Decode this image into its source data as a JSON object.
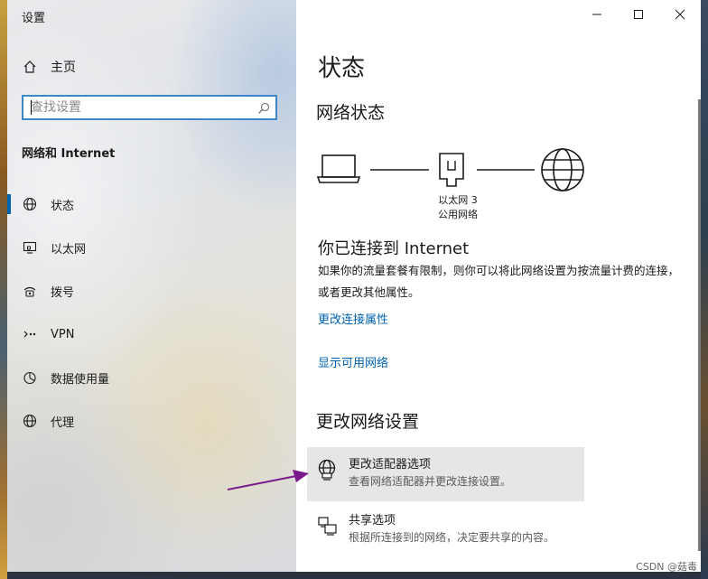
{
  "window": {
    "title": "设置",
    "controls": {
      "minimize": "—",
      "maximize": "☐",
      "close": "✕"
    }
  },
  "sidebar": {
    "home_label": "主页",
    "search_placeholder": "查找设置",
    "section_title": "网络和 Internet",
    "items": [
      {
        "label": "状态",
        "icon": "globe-icon",
        "active": true
      },
      {
        "label": "以太网",
        "icon": "ethernet-monitor-icon",
        "active": false
      },
      {
        "label": "拨号",
        "icon": "dialup-icon",
        "active": false
      },
      {
        "label": "VPN",
        "icon": "vpn-icon",
        "active": false
      },
      {
        "label": "数据使用量",
        "icon": "pie-chart-icon",
        "active": false
      },
      {
        "label": "代理",
        "icon": "globe-icon",
        "active": false
      }
    ]
  },
  "main": {
    "page_title": "状态",
    "network_status_heading": "网络状态",
    "diagram": {
      "adapter_name": "以太网 3",
      "network_type": "公用网络"
    },
    "connected_title": "你已连接到 Internet",
    "connected_desc": "如果你的流量套餐有限制，则你可以将此网络设置为按流量计费的连接，或者更改其他属性。",
    "links": {
      "change_properties": "更改连接属性",
      "show_networks": "显示可用网络"
    },
    "change_settings_heading": "更改网络设置",
    "options": [
      {
        "title": "更改适配器选项",
        "subtitle": "查看网络适配器并更改连接设置。",
        "icon": "adapter-globe-icon",
        "highlighted": true
      },
      {
        "title": "共享选项",
        "subtitle": "根据所连接到的网络，决定要共享的内容。",
        "icon": "sharing-icon",
        "highlighted": false
      }
    ]
  },
  "annotation": {
    "arrow_color": "#7a1a8c"
  },
  "watermark": "CSDN @菇毒",
  "colors": {
    "accent": "#0063b1",
    "search_border": "#3c87c9",
    "hover": "#e6e6e6"
  }
}
